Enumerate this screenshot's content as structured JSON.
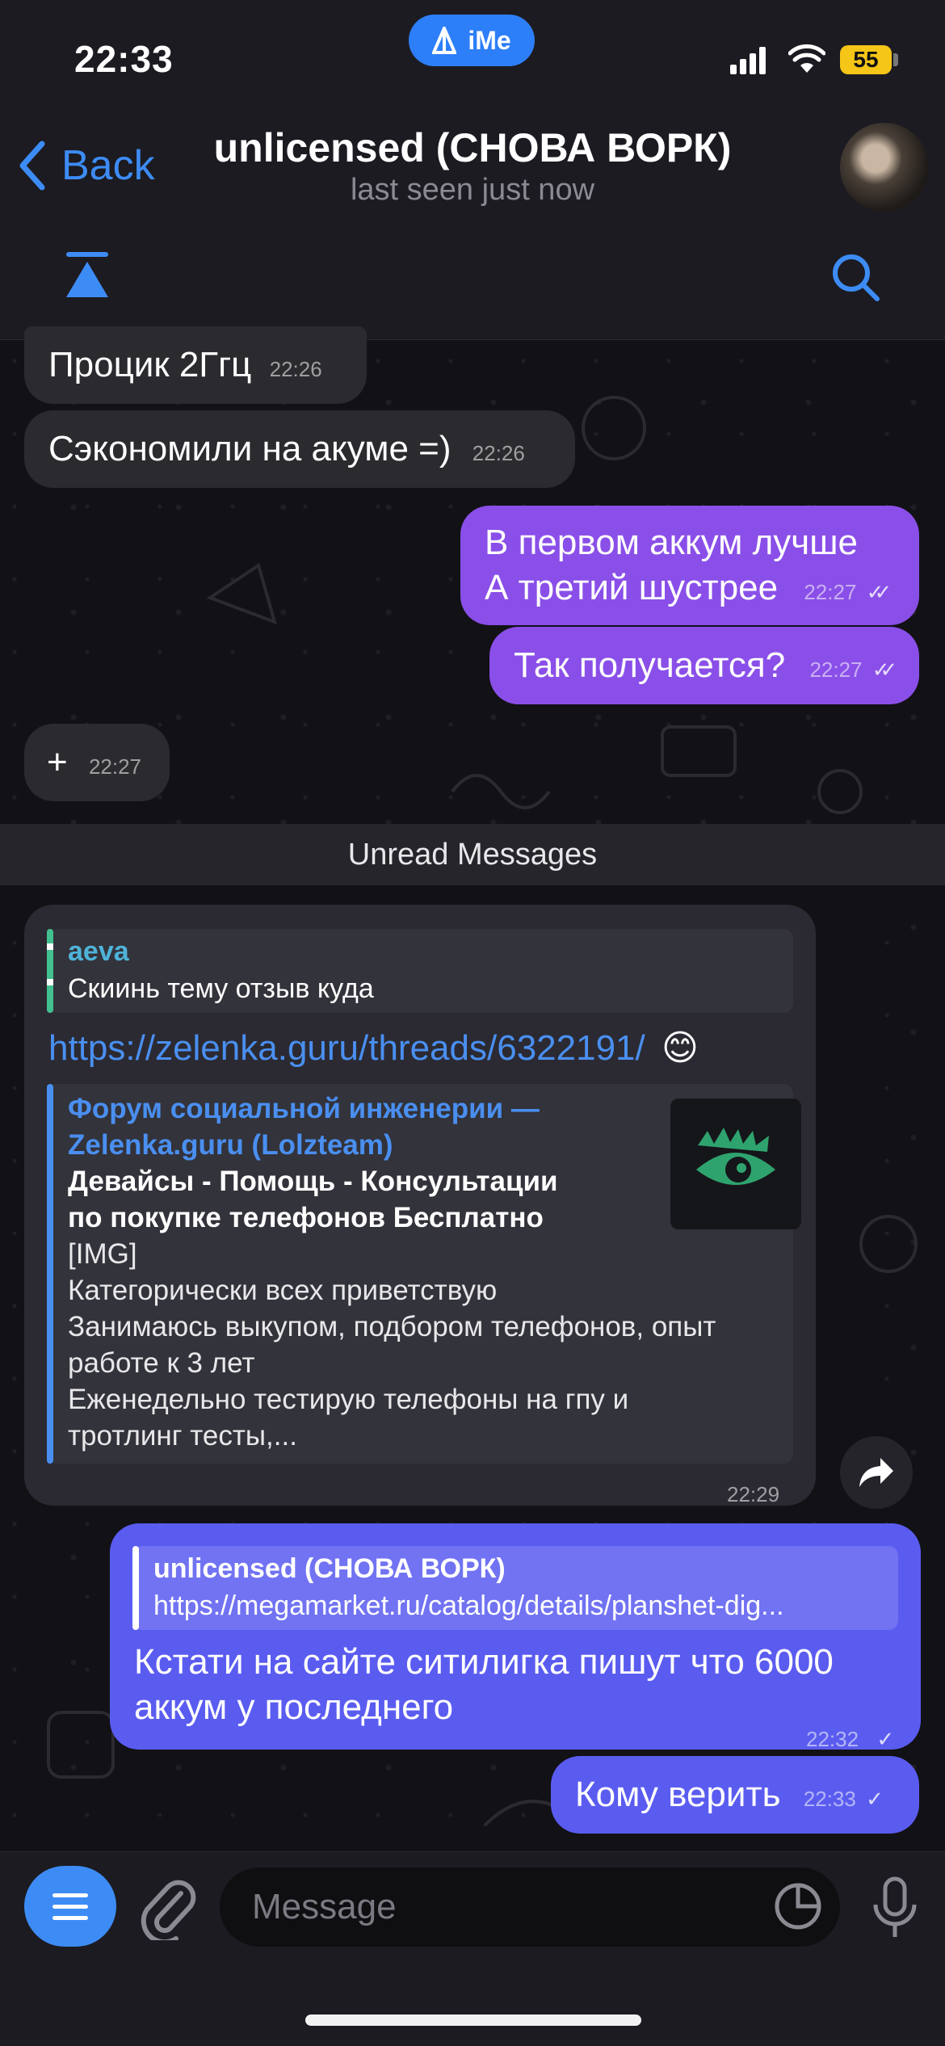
{
  "status": {
    "time": "22:33",
    "ime_label": "iMe",
    "battery": "55"
  },
  "header": {
    "back_label": "Back",
    "title": "unlicensed (СНОВА ВОРК)",
    "subtitle": "last seen just now"
  },
  "messages": {
    "m1": {
      "text": "Процик 2Ггц",
      "time": "22:26"
    },
    "m2": {
      "text": "Сэкономили на акуме =)",
      "time": "22:26"
    },
    "m3": {
      "line1": "В первом аккум лучше",
      "line2": "А третий шустрее",
      "time": "22:27"
    },
    "m4": {
      "text": "Так получается?",
      "time": "22:27"
    },
    "m5": {
      "text": "+",
      "time": "22:27"
    },
    "unread": "Unread Messages",
    "m6": {
      "reply_author": "aeva",
      "reply_text": "Скиинь тему отзыв куда",
      "link": "https://zelenka.guru/threads/6322191/",
      "emoji": "😊",
      "preview_site_line1": "Форум социальной инженерии —",
      "preview_site_line2": "Zelenka.guru (Lolzteam)",
      "preview_title_line1": "Девайсы - Помощь - Консультации",
      "preview_title_line2": "по покупке телефонов  Бесплатно",
      "preview_line3": "[IMG]",
      "preview_line4": "Категорически  всех приветствую",
      "preview_line5": "Занимаюсь выкупом, подбором телефонов, опыт",
      "preview_line6": "работе к 3 лет",
      "preview_line7": "Еженедельно тестирую телефоны на гпу и",
      "preview_line8": "тротлинг тесты,...",
      "time": "22:29"
    },
    "m7": {
      "reply_author": "unlicensed (СНОВА ВОРК)",
      "reply_text": "https://megamarket.ru/catalog/details/planshet-dig...",
      "line1": "Кстати на сайте ситилигка пишут что 6000",
      "line2": "аккум у последнего",
      "time": "22:32"
    },
    "m8": {
      "text": "Кому верить",
      "time": "22:33"
    }
  },
  "input": {
    "placeholder": "Message"
  },
  "colors": {
    "accent": "#3d8cf5",
    "outgoing": "#8a4fe8",
    "outgoing_alt": "#5a5cf0",
    "incoming": "#2a2a2f"
  }
}
